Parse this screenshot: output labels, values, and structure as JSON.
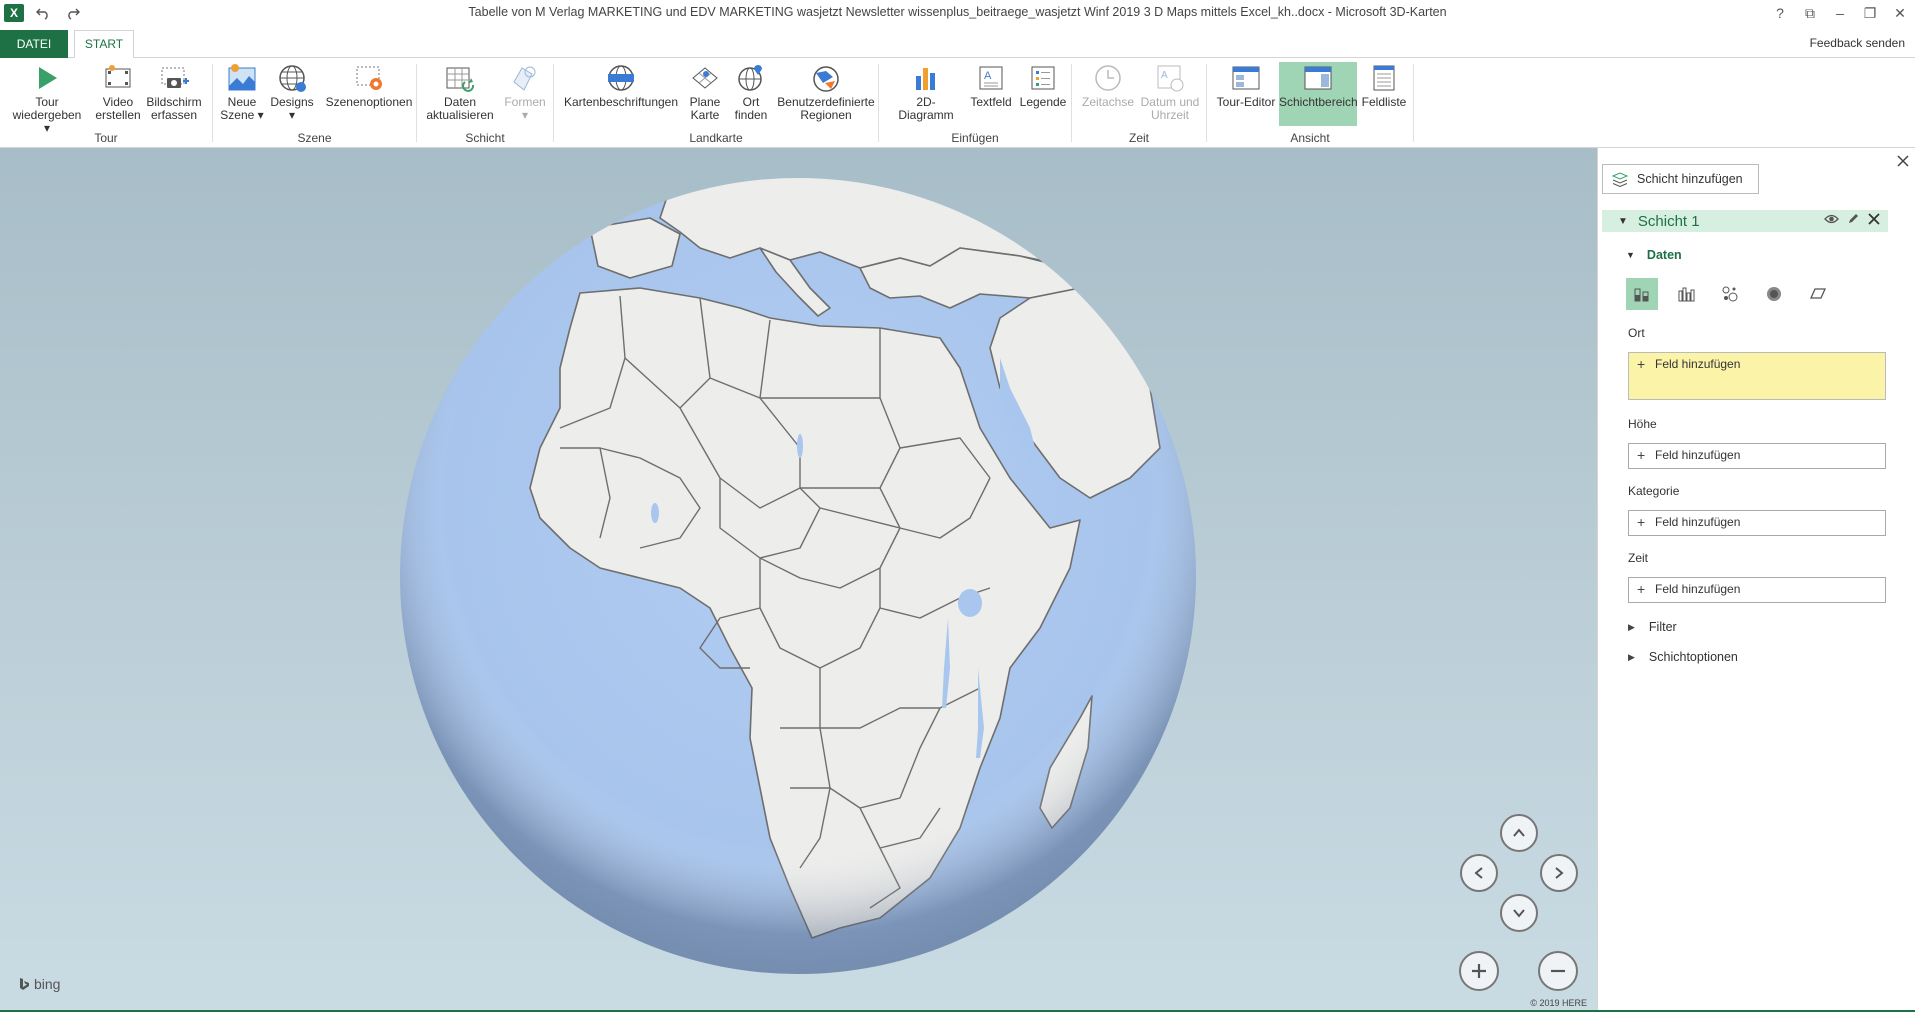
{
  "window": {
    "title": "Tabelle von M  Verlag MARKETING und EDV MARKETING wasjetzt Newsletter wissenplus_beitraege_wasjetzt Winf 2019 3 D Maps mittels Excel_kh..docx - Microsoft 3D-Karten",
    "app_icon_label": "X",
    "controls": {
      "help": "?",
      "restore_ribbon": "⧉",
      "minimize": "–",
      "maximize": "❐",
      "close": "✕"
    }
  },
  "tabs": {
    "file": "DATEI",
    "start": "START",
    "feedback": "Feedback senden"
  },
  "ribbon": {
    "groups": {
      "tour": "Tour",
      "szene": "Szene",
      "schicht": "Schicht",
      "landkarte": "Landkarte",
      "einfuegen": "Einfügen",
      "zeit": "Zeit",
      "ansicht": "Ansicht"
    },
    "buttons": {
      "tour_play_1": "Tour",
      "tour_play_2": "wiedergeben ▾",
      "video_1": "Video",
      "video_2": "erstellen",
      "screenshot_1": "Bildschirm",
      "screenshot_2": "erfassen",
      "new_scene_1": "Neue",
      "new_scene_2": "Szene ▾",
      "designs_1": "Designs",
      "designs_2": "▾",
      "scene_options": "Szenenoptionen",
      "refresh_1": "Daten",
      "refresh_2": "aktualisieren",
      "shapes_1": "Formen",
      "shapes_2": "▾",
      "map_labels": "Kartenbeschriftungen",
      "flat_map_1": "Plane",
      "flat_map_2": "Karte",
      "find_loc_1": "Ort",
      "find_loc_2": "finden",
      "custom_regions_1": "Benutzerdefinierte",
      "custom_regions_2": "Regionen",
      "chart_2d": "2D-Diagramm",
      "textbox": "Textfeld",
      "legend": "Legende",
      "timeline": "Zeitachse",
      "datetime_1": "Datum und",
      "datetime_2": "Uhrzeit",
      "tour_editor": "Tour-Editor",
      "layer_pane": "Schichtbereich",
      "field_list": "Feldliste"
    }
  },
  "map": {
    "attribution": "bing",
    "copyright": "© 2019 HERE",
    "colors": {
      "ocean": "#a9c6ee",
      "land": "#ededeb",
      "border": "#6e6e6e"
    }
  },
  "panel": {
    "add_layer": "Schicht hinzufügen",
    "layer_name": "Schicht 1",
    "data_section": "Daten",
    "fields": {
      "ort_label": "Ort",
      "ort_value": "Feld hinzufügen",
      "hoehe_label": "Höhe",
      "hoehe_value": "Feld hinzufügen",
      "kategorie_label": "Kategorie",
      "kategorie_value": "Feld hinzufügen",
      "zeit_label": "Zeit",
      "zeit_value": "Feld hinzufügen"
    },
    "filter": "Filter",
    "layer_options": "Schichtoptionen"
  }
}
